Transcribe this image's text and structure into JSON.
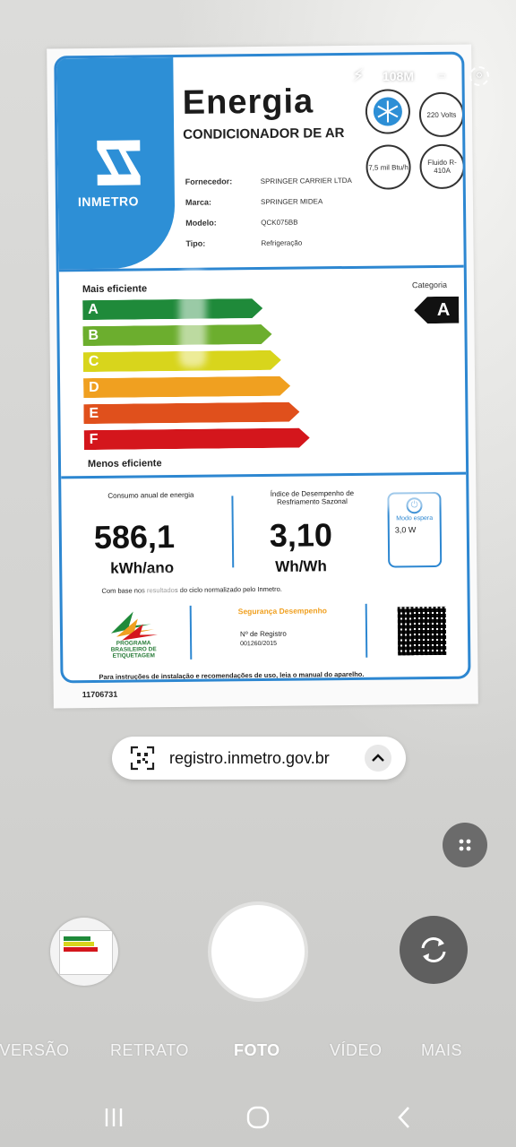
{
  "status": {
    "megapixels": "108M",
    "flash_icon": "flash-off-icon",
    "ratio_icon": "ratio-icon",
    "settings_icon": "settings-icon"
  },
  "label": {
    "logo_text": "INMETRO",
    "title": "Energia",
    "subtitle": "CONDICIONADOR DE AR",
    "specs": [
      {
        "key": "Fornecedor:",
        "value": "SPRINGER CARRIER LTDA"
      },
      {
        "key": "Marca:",
        "value": "SPRINGER MIDEA"
      },
      {
        "key": "Modelo:",
        "value": "QCK075BB"
      },
      {
        "key": "Tipo:",
        "value": "Refrigeração"
      }
    ],
    "circles": [
      "220 Volts",
      "7,5 mil Btu/h",
      "Fluido R-410A"
    ],
    "more_efficient": "Mais eficiente",
    "less_efficient": "Menos eficiente",
    "category_label": "Categoria",
    "category": "A",
    "classes": [
      {
        "letter": "A",
        "color": "#1f8a3a",
        "width": 0.59
      },
      {
        "letter": "B",
        "color": "#6cae2e",
        "width": 0.62
      },
      {
        "letter": "C",
        "color": "#d8d51c",
        "width": 0.65
      },
      {
        "letter": "D",
        "color": "#f0a020",
        "width": 0.68
      },
      {
        "letter": "E",
        "color": "#e0501c",
        "width": 0.71
      },
      {
        "letter": "F",
        "color": "#d4161c",
        "width": 0.74
      }
    ],
    "consumption_label": "Consumo anual de energia",
    "consumption_value": "586,1",
    "consumption_unit": "kWh/ano",
    "idrs_label": "Índice de Desempenho de Resfriamento Sazonal",
    "idrs_value": "3,10",
    "idrs_unit": "Wh/Wh",
    "standby_label": "Modo espera",
    "standby_value": "3,0 W",
    "note": "Com base nos resultados do ciclo normalizado pelo Inmetro.",
    "program_text": "PROGRAMA BRASILEIRO DE ETIQUETAGEM",
    "safety_text": "Segurança Desempenho",
    "register_label": "Nº de Registro",
    "register_number": "001260/2015",
    "instructions": "Para instruções de instalação e recomendações de uso, leia o manual do aparelho.",
    "serial": "11706731"
  },
  "qr_result": {
    "url": "registro.inmetro.gov.br",
    "icon": "qr-scan-icon",
    "expand_icon": "chevron-up-icon"
  },
  "modes": [
    "IVERSÃO",
    "RETRATO",
    "FOTO",
    "VÍDEO",
    "MAIS"
  ],
  "active_mode": "FOTO"
}
